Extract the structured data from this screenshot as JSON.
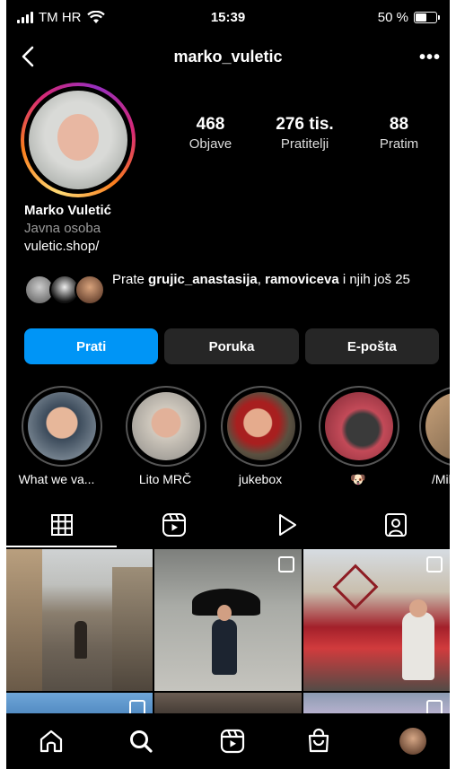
{
  "status_bar": {
    "carrier": "TM HR",
    "time": "15:39",
    "battery": "50 %"
  },
  "header": {
    "username": "marko_vuletic"
  },
  "stats": [
    {
      "value": "468",
      "label": "Objave"
    },
    {
      "value": "276 tis.",
      "label": "Pratitelji"
    },
    {
      "value": "88",
      "label": "Pratim"
    }
  ],
  "bio": {
    "name": "Marko Vuletić",
    "category": "Javna osoba",
    "link": "vuletic.shop/"
  },
  "followed_by": {
    "prefix": "Prate ",
    "user1": "grujic_anastasija",
    "sep": ", ",
    "user2": "ramoviceva",
    "suffix": " i njih još 25"
  },
  "buttons": {
    "follow": "Prati",
    "message": "Poruka",
    "email": "E-pošta"
  },
  "highlights": [
    {
      "label": "What we va..."
    },
    {
      "label": "Lito MRČ"
    },
    {
      "label": "jukebox"
    },
    {
      "label": "🐶"
    },
    {
      "label": "/Mil"
    }
  ],
  "tabs": [
    {
      "icon": "grid-icon"
    },
    {
      "icon": "reels-icon"
    },
    {
      "icon": "video-icon"
    },
    {
      "icon": "tagged-icon"
    }
  ],
  "nav": [
    {
      "icon": "home-icon"
    },
    {
      "icon": "search-icon"
    },
    {
      "icon": "reels-icon"
    },
    {
      "icon": "shop-icon"
    },
    {
      "icon": "profile-avatar"
    }
  ],
  "colors": {
    "accent": "#0095f6",
    "button_bg": "#262626",
    "background": "#000000"
  }
}
